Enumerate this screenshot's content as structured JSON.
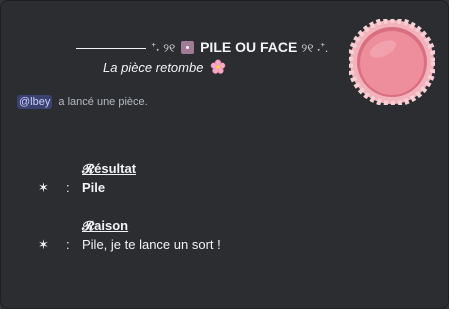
{
  "embed": {
    "title_decor_left": "⁺˖ ୨୧",
    "title_text": "PILE OU FACE",
    "title_decor_right": "୨୧ ˖⁺.",
    "subtitle": "La pièce retombe",
    "action": {
      "mention": "@lbey",
      "text": "a lancé une pièce."
    },
    "fields": [
      {
        "name": "𝓡ésultat",
        "bullet": "✶",
        "separator": ":",
        "value": "Pile"
      },
      {
        "name": "𝓡aison",
        "bullet": "✶",
        "separator": ":",
        "value": "Pile, je te lance un sort !"
      }
    ],
    "icons": {
      "title": "die-icon",
      "subtitle": "cherry-blossom-icon",
      "thumbnail": "pink-coin-icon"
    },
    "colors": {
      "background": "#2b2d31",
      "mention_bg": "#3c4270",
      "mention_text": "#c9cdfb",
      "coin": "#e88a98"
    }
  }
}
